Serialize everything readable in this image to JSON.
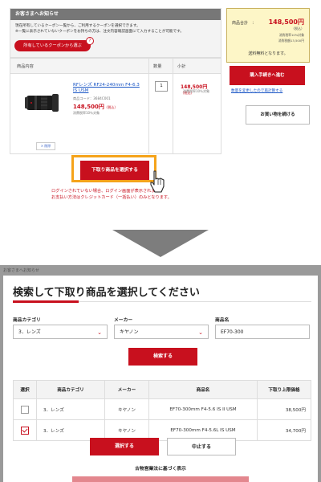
{
  "cart": {
    "notice": {
      "title": "お客さまへお知らせ",
      "line1": "現在所有しているクーポン一覧から、ご利用するクーポンを選択できます。",
      "line2": "※一覧に表示されていないクーポンをお持ちの方は、注文内容確認画面にて入力することが可能です。",
      "coupon_button": "所有しているクーポンから選ぶ",
      "coupon_badge": "?"
    },
    "table": {
      "headers": {
        "product": "商品内容",
        "quantity": "数量",
        "subtotal": "小計"
      },
      "item": {
        "name": "RFレンズ RF24-240mm F4-6.3 IS USM",
        "code": "商品コード：3684C001",
        "price": "148,500円",
        "price_suffix": "（税込）",
        "tax_note": "消費税率10％対象",
        "quantity": "1",
        "subtotal": "148,500円",
        "subtotal_suffix": "（税込）",
        "subtotal_tax": "消費税率10％対象",
        "delete_label": "× 削除"
      }
    },
    "trade_in_button": "下取り商品を選択する",
    "login_note1": "ログインされていない場合、ログイン画面が表示されます。",
    "login_note2": "お支払い方法はクレジットカード（一括払い）のみとなります。",
    "summary": {
      "label": "商品合計　：",
      "amount": "148,500円",
      "tax_included": "（税込）",
      "tax_line1": "消費税率10%対象",
      "tax_line2": "消費税額13,500円",
      "shipping": "送料無料となります。"
    },
    "checkout_button": "購入手続きへ進む",
    "checkout_link": "数量を変更したので再計算する",
    "continue_button": "お買い物を続ける"
  },
  "modal": {
    "behind_text": "お客さまへお知らせ",
    "title": "検索して下取り商品を選択してください",
    "filters": {
      "category_label": "商品カテゴリ",
      "category_value": "3．レンズ",
      "maker_label": "メーカー",
      "maker_value": "キヤノン",
      "product_label": "商品名",
      "product_value": "EF70-300"
    },
    "search_button": "検索する",
    "results": {
      "headers": [
        "選択",
        "商品カテゴリ",
        "メーカー",
        "商品名",
        "下取り上限価格"
      ],
      "rows": [
        {
          "category": "3．レンズ",
          "maker": "キヤノン",
          "name": "EF70-300mm F4-5.6 IS II USM",
          "price": "38,500円",
          "checked": false
        },
        {
          "category": "3．レンズ",
          "maker": "キヤノン",
          "name": "EF70-300mm F4-5.6L IS USM",
          "price": "34,700円",
          "checked": true
        }
      ]
    },
    "select_button": "選択する",
    "cancel_button": "中止する",
    "footer_link": "古物営業法に基づく表示"
  },
  "colors": {
    "accent": "#c8101e",
    "highlight": "#f5a31a",
    "summary_bg": "#fdf6c7"
  }
}
